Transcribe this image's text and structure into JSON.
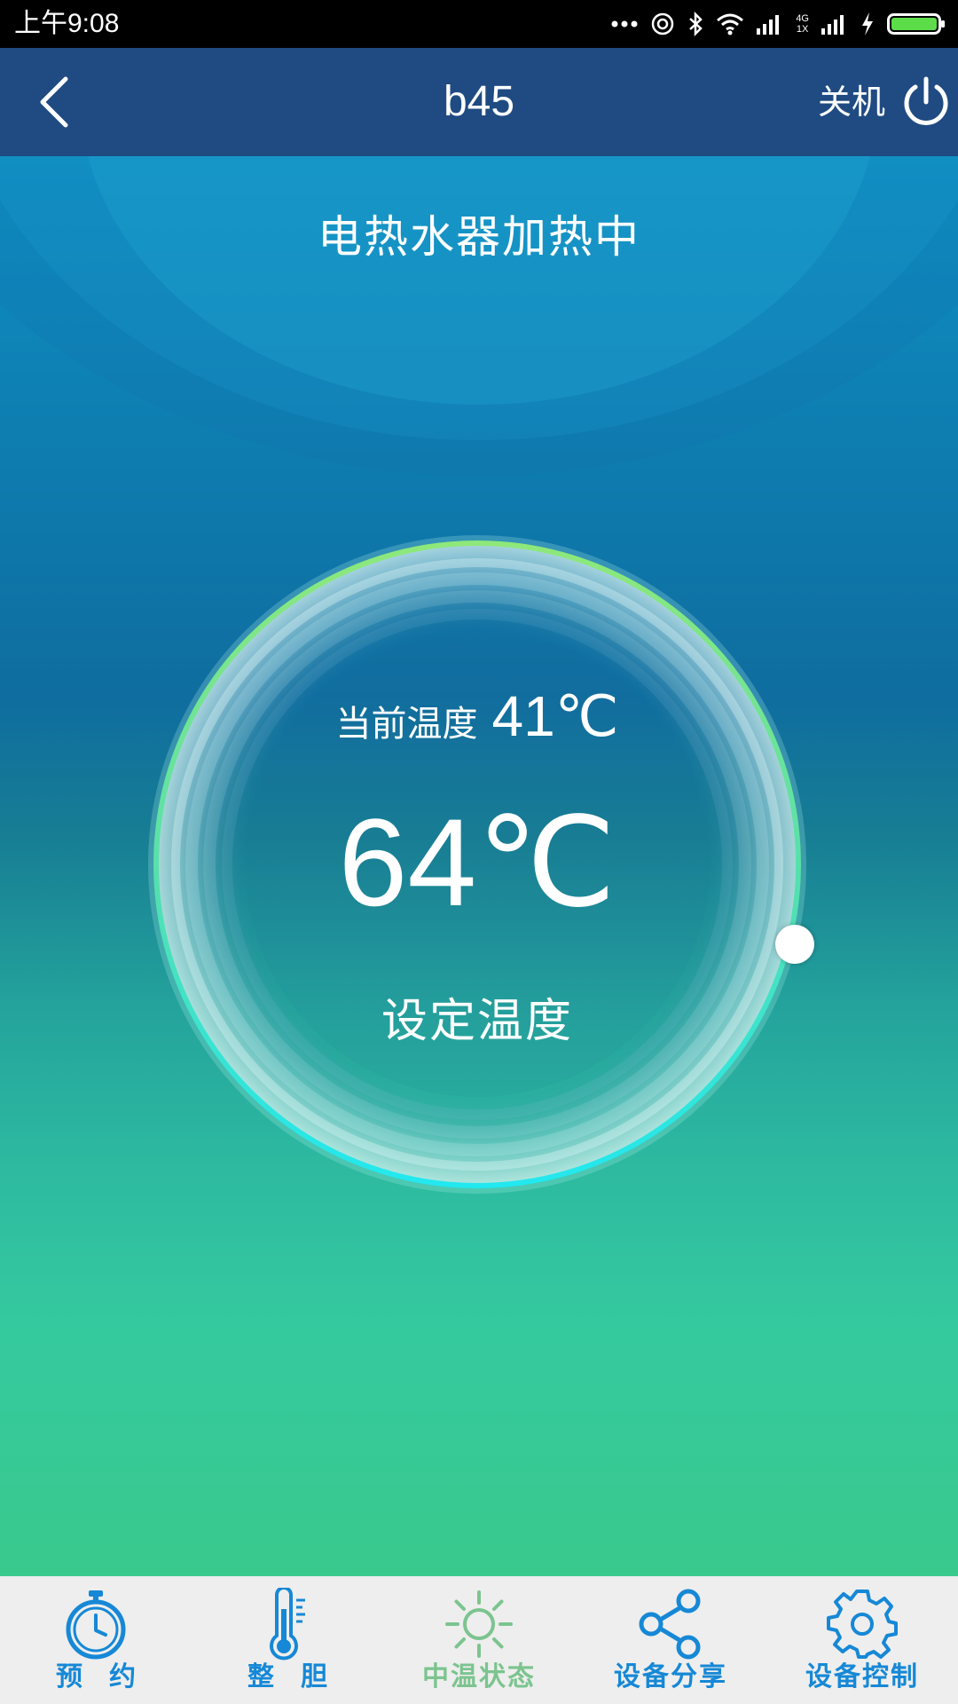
{
  "status_bar": {
    "time": "上午9:08",
    "network_top": "4G",
    "network_bottom": "1X"
  },
  "header": {
    "title": "b45",
    "power_label": "关机"
  },
  "main": {
    "status_message": "电热水器加热中",
    "current_temp_label": "当前温度",
    "current_temp_value": "41℃",
    "set_temp_value": "64℃",
    "set_temp_label": "设定温度",
    "dial_fraction": 0.36
  },
  "bottom_nav": {
    "items": [
      {
        "label": "预约",
        "icon": "stopwatch-icon"
      },
      {
        "label": "整胆",
        "icon": "thermometer-icon"
      },
      {
        "label": "中温状态",
        "icon": "sun-icon"
      },
      {
        "label": "设备分享",
        "icon": "share-icon"
      },
      {
        "label": "设备控制",
        "icon": "gear-icon"
      }
    ]
  },
  "colors": {
    "header_bg": "#1f4b82",
    "nav_active": "#1688d6",
    "nav_inactive": "#7cc48f",
    "ring_top": "#8ee87a",
    "ring_bottom": "#22e8f0"
  }
}
